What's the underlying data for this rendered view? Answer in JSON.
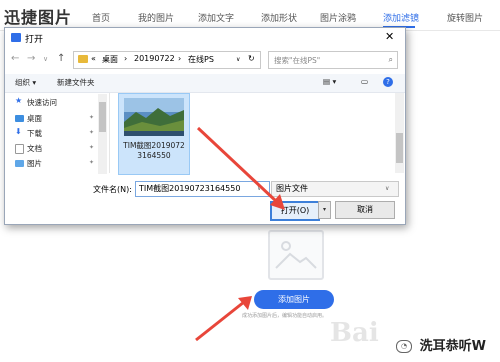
{
  "app": {
    "title": "迅捷图片"
  },
  "nav": [
    {
      "label": "首页"
    },
    {
      "label": "我的图片"
    },
    {
      "label": "添加文字"
    },
    {
      "label": "添加形状"
    },
    {
      "label": "图片涂鸦"
    },
    {
      "label": "添加滤镜"
    },
    {
      "label": "旋转图片"
    }
  ],
  "active_tab": "添加滤镜",
  "dialog": {
    "title": "打开",
    "close": "✕",
    "back": "←",
    "forward": "→",
    "dropdown": "∨",
    "up": "↑",
    "breadcrumb": [
      "«",
      "桌面",
      "›",
      "20190722",
      "›",
      "在线PS"
    ],
    "breadcrumb_dd": "∨",
    "refresh": "↻",
    "search_placeholder": "搜索\"在线PS\"",
    "search_icon": "⌕",
    "toolbar": {
      "organize": "组织 ▾",
      "new_folder": "新建文件夹",
      "view": "▤ ▾",
      "pane": "▭",
      "help": "?"
    },
    "sidebar": [
      {
        "label": "快速访问",
        "icon": "star-icon",
        "pinned": false
      },
      {
        "label": "桌面",
        "icon": "desktop-icon",
        "pinned": true
      },
      {
        "label": "下载",
        "icon": "download-icon",
        "pinned": true
      },
      {
        "label": "文档",
        "icon": "document-icon",
        "pinned": true
      },
      {
        "label": "图片",
        "icon": "pictures-icon",
        "pinned": true
      }
    ],
    "pin_glyph": "📌",
    "file": {
      "name": "TIM截图20190723164550"
    },
    "filename_label": "文件名(N):",
    "filename_value": "TIM截图20190723164550",
    "filetype": "图片文件",
    "open_button": "打开(O)",
    "open_dd": "▾",
    "cancel_button": "取消"
  },
  "page": {
    "add_image_button": "添加图片",
    "hint": "成功添加图片后，编辑功能自动启用。",
    "watermark": "Bai",
    "wechat_name": "洗耳恭听W",
    "wechat_glyph": "◔"
  },
  "colors": {
    "accent": "#2f6ee8",
    "arrow": "#e8463a"
  }
}
